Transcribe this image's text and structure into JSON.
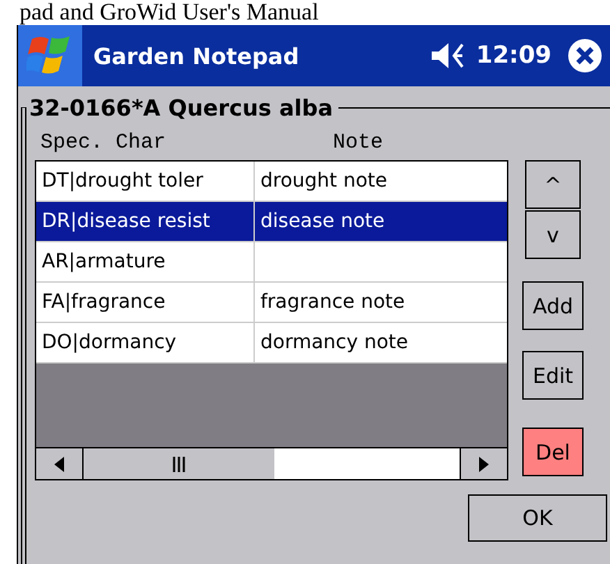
{
  "caption": "pad and GroWid User's Manual",
  "title_bar": {
    "title": "Garden Notepad",
    "time": "12:09"
  },
  "group": {
    "title": "32-0166*A Quercus alba"
  },
  "table": {
    "columns": [
      "Spec. Char",
      "Note"
    ],
    "rows": [
      {
        "cells": [
          "DT|drought toler",
          "drought note"
        ],
        "selected": false
      },
      {
        "cells": [
          "DR|disease resist",
          "disease note"
        ],
        "selected": true
      },
      {
        "cells": [
          "AR|armature",
          ""
        ],
        "selected": false
      },
      {
        "cells": [
          "FA|fragrance",
          "fragrance note"
        ],
        "selected": false
      },
      {
        "cells": [
          "DO|dormancy",
          "dormancy note"
        ],
        "selected": false
      }
    ]
  },
  "side_buttons": [
    {
      "label": "^",
      "kind": "arrow"
    },
    {
      "label": "v",
      "kind": "arrow"
    },
    {
      "label": "Add",
      "kind": "normal"
    },
    {
      "label": "Edit",
      "kind": "normal"
    },
    {
      "label": "Del",
      "kind": "danger"
    }
  ],
  "ok_button": "OK"
}
